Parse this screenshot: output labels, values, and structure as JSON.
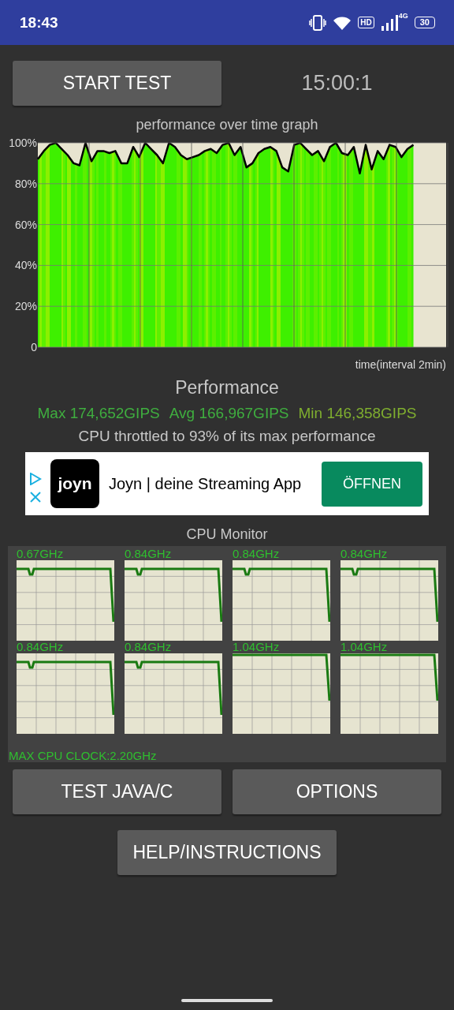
{
  "status_bar": {
    "time": "18:43",
    "hd_badge": "HD",
    "network": "4G",
    "battery": "30"
  },
  "start_button": "START TEST",
  "timer": "15:00:1",
  "graph": {
    "chart_data": {
      "type": "line",
      "title": "performance over time graph",
      "xlabel": "time(interval 2min)",
      "ylim": [
        0,
        100
      ],
      "grid": true,
      "yticks": [
        {
          "value": 0,
          "label": "0"
        },
        {
          "value": 20,
          "label": "20%"
        },
        {
          "value": 40,
          "label": "40%"
        },
        {
          "value": 60,
          "label": "60%"
        },
        {
          "value": 80,
          "label": "80%"
        },
        {
          "value": 100,
          "label": "100%"
        }
      ],
      "series": [
        {
          "color": "#000000",
          "values": [
            92,
            96,
            99,
            100,
            97,
            94,
            90,
            89,
            100,
            91,
            96,
            96,
            95,
            96,
            90,
            90,
            98,
            93,
            100,
            97,
            94,
            90,
            100,
            98,
            94,
            92,
            93,
            94,
            96,
            97,
            95,
            99,
            100,
            94,
            98,
            88,
            90,
            95,
            97,
            98,
            96,
            88,
            86,
            99,
            100,
            97,
            94,
            96,
            91,
            98,
            100,
            95,
            94,
            98,
            85,
            99,
            87,
            96,
            92,
            99,
            98,
            93,
            97,
            99
          ]
        }
      ]
    }
  },
  "performance": {
    "title": "Performance",
    "stats": [
      {
        "text": "Max 174,652GIPS",
        "color": "#3fae3f"
      },
      {
        "text": "Avg 166,967GIPS",
        "color": "#3fae3f"
      },
      {
        "text": "Min 146,358GIPS",
        "color": "#7fae2f"
      }
    ],
    "throttle": "CPU throttled to 93% of its max performance"
  },
  "ad": {
    "logo": "joyn",
    "title": "Joyn | deine Streaming App",
    "button": "ÖFFNEN"
  },
  "cpu_monitor": {
    "title": "CPU Monitor",
    "cores": [
      {
        "freq": "0.67GHz",
        "kind": "dip"
      },
      {
        "freq": "0.84GHz",
        "kind": "dip"
      },
      {
        "freq": "0.84GHz",
        "kind": "dip"
      },
      {
        "freq": "0.84GHz",
        "kind": "dip"
      },
      {
        "freq": "0.84GHz",
        "kind": "dip"
      },
      {
        "freq": "0.84GHz",
        "kind": "dip"
      },
      {
        "freq": "1.04GHz",
        "kind": "flat"
      },
      {
        "freq": "1.04GHz",
        "kind": "flat"
      }
    ],
    "max_clock": "MAX CPU CLOCK:2.20GHz"
  },
  "buttons": [
    "TEST JAVA/C",
    "OPTIONS"
  ],
  "help_button": "HELP/INSTRUCTIONS"
}
